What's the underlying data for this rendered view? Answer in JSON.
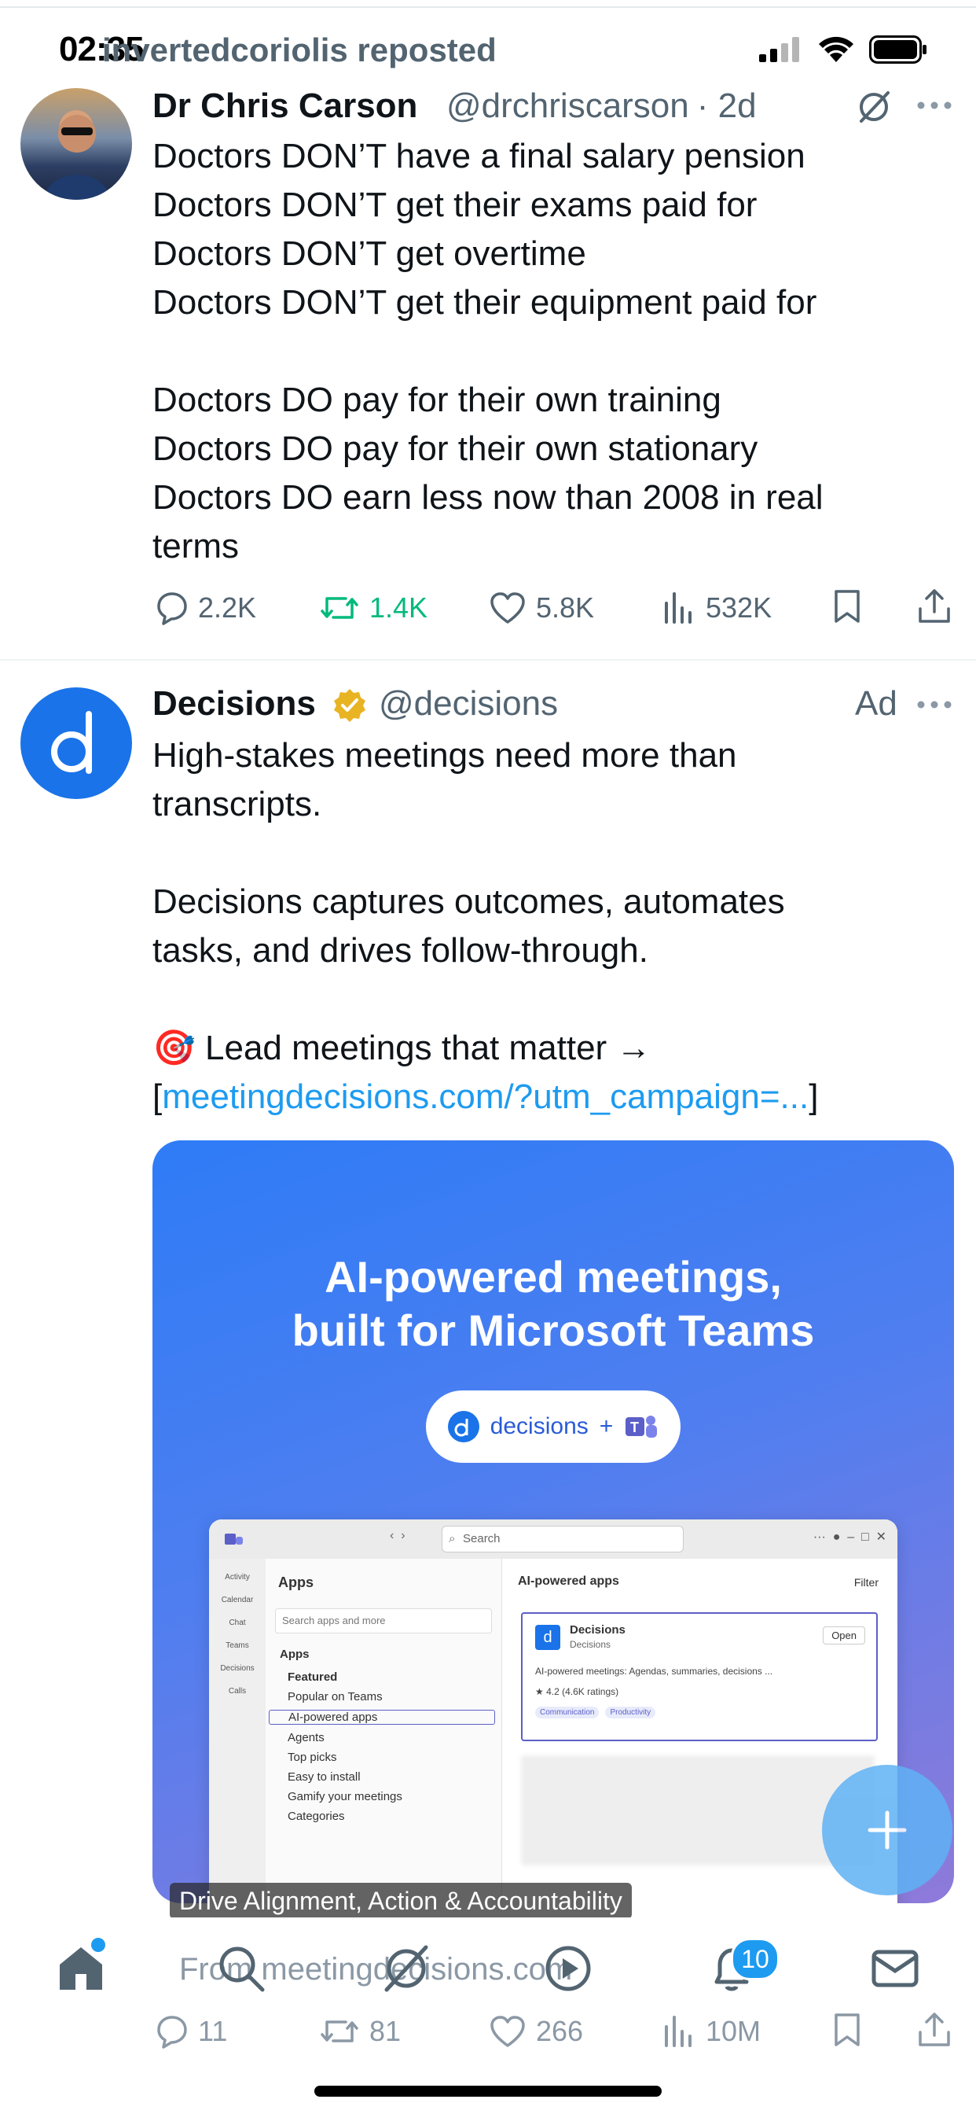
{
  "status_bar": {
    "time": "02:35"
  },
  "repost": {
    "text": "invertedcoriolis reposted"
  },
  "tweet1": {
    "name": "Dr Chris Carson",
    "handle": "@drchriscarson",
    "time": "· 2d",
    "lines": [
      "Doctors DON’T have a final salary pension",
      "Doctors DON’T get their exams paid for",
      "Doctors DON’T get overtime",
      "Doctors DON’T get their equipment paid for",
      "",
      "Doctors DO pay for their own training",
      "Doctors DO pay for their own stationary",
      "Doctors DO earn less now than 2008 in real",
      "terms"
    ],
    "replies": "2.2K",
    "reposts": "1.4K",
    "likes": "5.8K",
    "views": "532K"
  },
  "tweet2": {
    "name": "Decisions",
    "handle": "@decisions",
    "ad_label": "Ad",
    "lines": [
      "High-stakes meetings need more than",
      "transcripts.",
      "",
      "Decisions captures outcomes, automates",
      "tasks, and drives follow-through.",
      "",
      "🎯 Lead meetings that matter →"
    ],
    "link_prefix": "[",
    "link": "meetingdecisions.com/?utm_campaign=...",
    "link_suffix": "]",
    "card": {
      "title_line1": "AI-powered meetings,",
      "title_line2": "built for Microsoft Teams",
      "pill_text": "decisions",
      "pill_plus": "+",
      "caption": "Drive Alignment, Action & Accountability",
      "teams": {
        "search": "Search",
        "apps_title": "Apps",
        "search_apps": "Search apps and more",
        "apps_section": "Apps",
        "menu": [
          "Featured",
          "Popular on Teams",
          "AI-powered apps",
          "Agents",
          "Top picks",
          "Easy to install",
          "Gamify your meetings",
          "Categories"
        ],
        "rail": [
          "Activity",
          "Calendar",
          "Chat",
          "Teams",
          "Decisions",
          "Calls"
        ],
        "right_title": "AI-powered apps",
        "filter": "Filter",
        "app_name": "Decisions",
        "app_sub": "Decisions",
        "open": "Open",
        "app_desc": "AI-powered meetings: Agendas, summaries, decisions ...",
        "rating": "4.2 (4.6K ratings)",
        "tags": [
          "Communication",
          "Productivity"
        ]
      }
    },
    "from": "From meetingdecisions.com",
    "replies": "11",
    "reposts": "81",
    "likes": "266",
    "views": "10M"
  },
  "bottom_nav": {
    "notifications_count": "10"
  },
  "colors": {
    "accent": "#1d9bf0",
    "repost_active": "#00ba7c",
    "secondary_text": "#536471"
  }
}
